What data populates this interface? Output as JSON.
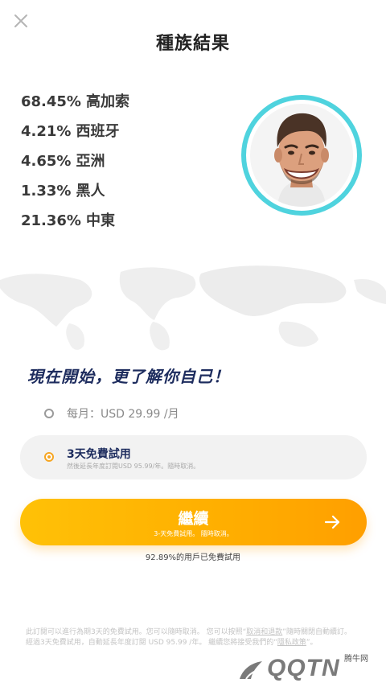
{
  "header": {
    "title": "種族結果"
  },
  "results": [
    {
      "percent": "68.45%",
      "label": "高加索"
    },
    {
      "percent": "4.21%",
      "label": "西班牙"
    },
    {
      "percent": "4.65%",
      "label": "亞洲"
    },
    {
      "percent": "1.33%",
      "label": "黑人"
    },
    {
      "percent": "21.36%",
      "label": "中東"
    }
  ],
  "tagline": "現在開始，更了解你自己！",
  "plans": {
    "monthly": {
      "label": "每月：USD 29.99 /月",
      "selected": false
    },
    "trial": {
      "label": "3天免費試用",
      "sublabel": "然後延長年度訂閱USD 95.99/年。隨時取消。",
      "selected": true
    }
  },
  "cta": {
    "label": "繼續",
    "sublabel": "3-天免費試用。 隨時取消。"
  },
  "trial_stat": "92.89%的用戶已免費試用",
  "footer": {
    "text_1": "此訂閱可以進行為期3天的免費試用。您可以隨時取消。 您可以按照“",
    "link_1": "取消和退款",
    "text_2": "”隨時關閉自動續訂。 經過3天免費試用，自動延長年度訂閱 USD 95.99 /年。 繼續您將接受我們的“",
    "link_2": "隱私政策",
    "text_3": "”。"
  },
  "watermark": {
    "logo_text": "QQTN",
    "small_text": "腾牛网"
  },
  "colors": {
    "accent_orange": "#FFB300",
    "navy": "#1D2C5E",
    "ring_cyan": "#4FD3DE"
  }
}
